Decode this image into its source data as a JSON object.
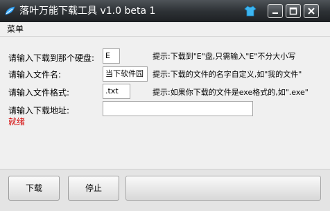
{
  "window": {
    "title": "落叶万能下载工具 v1.0 beta 1"
  },
  "icons": {
    "app": "leaf-app-icon",
    "skin": "shirt-icon",
    "minimize": "minimize-icon",
    "maximize": "maximize-icon",
    "close": "close-icon"
  },
  "menu": {
    "label": "菜单"
  },
  "form": {
    "disk_label": "请输入下载到那个硬盘:",
    "disk_value": "E",
    "disk_hint": "提示:下载到\"E\"盘,只需输入\"E\"不分大小写",
    "filename_label": "请输入文件名:",
    "filename_value": "当下软件园",
    "filename_hint": "提示:下载的文件的名字自定义,如\"我的文件\"",
    "format_label": "请输入文件格式:",
    "format_value": ".txt",
    "format_hint": "提示:如果你下载的文件是exe格式的,如\".exe\"",
    "url_label": "请输入下载地址:",
    "url_value": ""
  },
  "status": {
    "text": "就绪",
    "color": "#d40000"
  },
  "actions": {
    "download_label": "下载",
    "stop_label": "停止"
  },
  "progress": {
    "value": 0
  }
}
